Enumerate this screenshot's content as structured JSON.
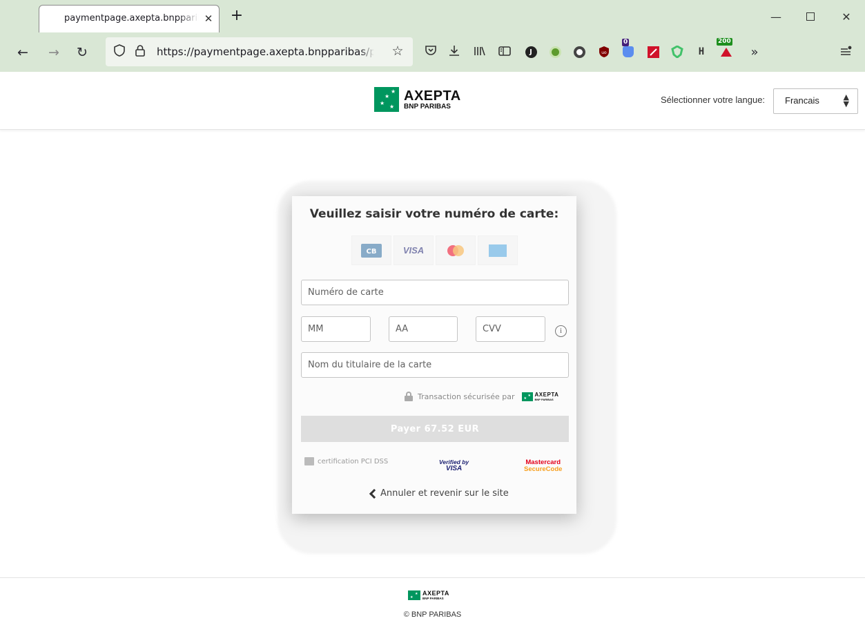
{
  "browser": {
    "tab_title": "paymentpage.axepta.bnpparibas",
    "url": "https://paymentpage.axepta.bnpparibas/payssl",
    "extension_badges": {
      "notification": "0",
      "status_code": "200"
    }
  },
  "header": {
    "logo": {
      "name": "AXEPTA",
      "sub": "BNP PARIBAS"
    },
    "language_label": "Sélectionner votre langue:",
    "language_value": "Francais"
  },
  "payment": {
    "title": "Veuillez saisir votre numéro de carte:",
    "card_brands": [
      "cb",
      "visa",
      "mastercard",
      "amex"
    ],
    "fields": {
      "card_number_placeholder": "Numéro de carte",
      "month_placeholder": "MM",
      "year_placeholder": "AA",
      "cvv_placeholder": "CVV",
      "holder_placeholder": "Nom du titulaire de la carte"
    },
    "secured_by": "Transaction sécurisée par",
    "pay_button": "Payer 67.52 EUR",
    "certification": "certification PCI DSS",
    "verified_by_visa": {
      "line1": "Verified by",
      "line2": "VISA"
    },
    "mastercard_securecode": {
      "line1": "Mastercard",
      "line2": "SecureCode"
    },
    "cancel_link": "Annuler et revenir sur le site"
  },
  "footer": {
    "copyright": "© BNP PARIBAS"
  },
  "colors": {
    "brand_green": "#00965e",
    "browser_chrome": "#d9e7d5",
    "button_disabled": "#dedede"
  }
}
